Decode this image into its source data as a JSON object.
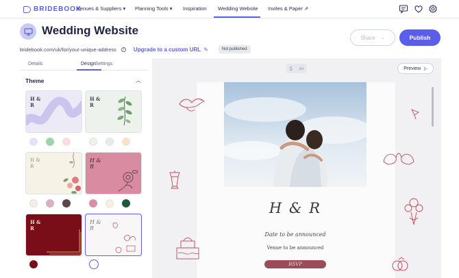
{
  "brand": {
    "name": "BRIDEBOOK"
  },
  "nav": {
    "items": [
      {
        "label": "Venues & Suppliers ▾"
      },
      {
        "label": "Planning Tools ▾"
      },
      {
        "label": "Inspiration"
      },
      {
        "label": "Wedding Website"
      },
      {
        "label": "Invites & Paper ⇗"
      }
    ],
    "icons": [
      "message-icon",
      "heart-icon",
      "settings-icon"
    ]
  },
  "header": {
    "title": "Wedding Website",
    "url": "bridebook.com/uk/for/your-unique-address",
    "upgrade_label": "Upgrade to a custom URL",
    "status_badge": "Not published",
    "share_label": "Share",
    "publish_label": "Publish"
  },
  "sidebar": {
    "tabs": [
      {
        "label": "Details"
      },
      {
        "label": "Design"
      },
      {
        "label": "Settings"
      }
    ],
    "active_tab": "Design",
    "section_title": "Theme",
    "themes": [
      {
        "monogram": "H &\nR",
        "bg": "#eceaf7",
        "swatches": [
          "#e3e3f5",
          "#9ed4a8",
          "#f6dfe1"
        ]
      },
      {
        "monogram": "H &\nR",
        "bg": "#edf3ec",
        "swatches": [
          "#eef1ee",
          "#e5ece6",
          "#f6e1cf"
        ]
      },
      {
        "monogram": "H &\nR",
        "bg": "#f7f2e6",
        "swatches": [
          "#f1efe7",
          "#d5b1c1",
          "#5a4648"
        ]
      },
      {
        "monogram": "H &\nR",
        "bg": "#d98ba2",
        "swatches": [
          "#da8da4",
          "#f7f2e8",
          "#23573c"
        ]
      },
      {
        "monogram": "H &\nR",
        "bg": "#7a0e18",
        "swatches": [
          "#7a0e18"
        ]
      },
      {
        "monogram": "H &\nR",
        "bg": "#f8f6f6",
        "swatches": [
          "#ffffff"
        ],
        "selected": true
      }
    ]
  },
  "preview": {
    "button_label": "Preview",
    "names": "H & R",
    "date_text": "Date to be announced",
    "venue_text": "Venue to be announced",
    "rsvp_label": "RSVP"
  },
  "colors": {
    "accent": "#5b5ee8",
    "rsvp": "#9a4d58",
    "doodle": "#c3455a"
  }
}
